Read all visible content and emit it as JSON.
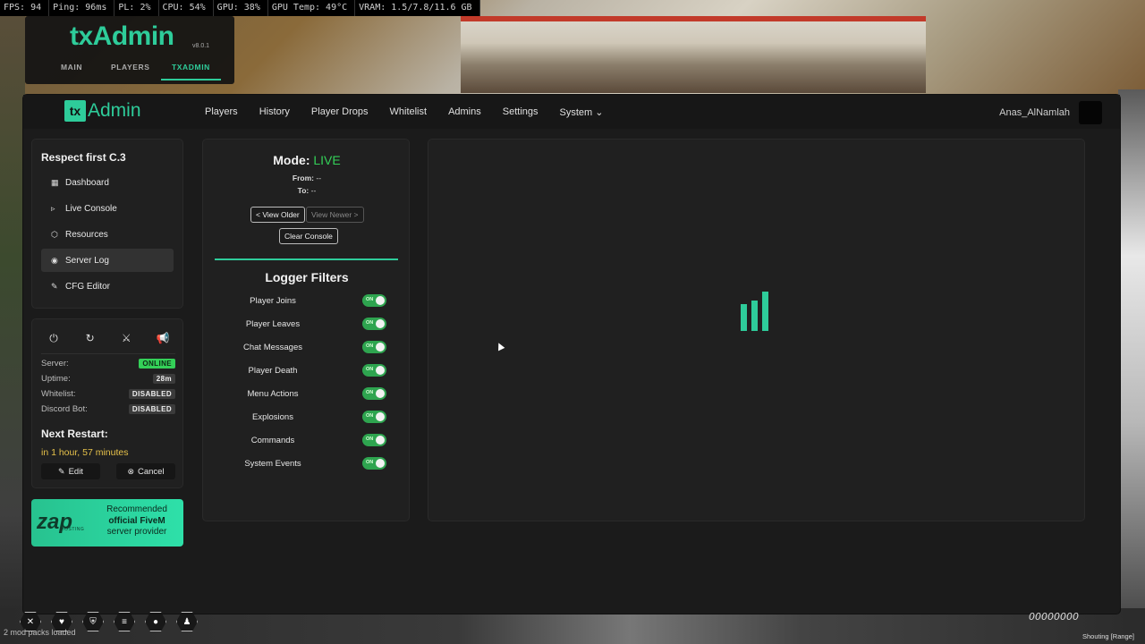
{
  "perf": {
    "fps": "FPS: 94",
    "ping": "Ping: 96ms",
    "pl": "PL: 2%",
    "cpu": "CPU: 54%",
    "gpu": "GPU: 38%",
    "gpu_temp": "GPU Temp: 49°C",
    "vram": "VRAM: 1.5/7.8/11.6 GB"
  },
  "overlay": {
    "logo": "txAdmin",
    "version": "v8.0.1",
    "tabs": [
      "MAIN",
      "PLAYERS",
      "TXADMIN"
    ],
    "active_tab": "TXADMIN"
  },
  "nav": {
    "brand_icon": "tx",
    "brand_text": "Admin",
    "links": [
      "Players",
      "History",
      "Player Drops",
      "Whitelist",
      "Admins",
      "Settings",
      "System ⌄"
    ],
    "username": "Anas_AlNamlah"
  },
  "sidebar": {
    "server_name": "Respect first C.3",
    "items": [
      {
        "label": "Dashboard",
        "icon": "dashboard-icon",
        "glyph": "▦"
      },
      {
        "label": "Live Console",
        "icon": "console-icon",
        "glyph": "▹"
      },
      {
        "label": "Resources",
        "icon": "cube-icon",
        "glyph": "⬡"
      },
      {
        "label": "Server Log",
        "icon": "eye-icon",
        "glyph": "◉"
      },
      {
        "label": "CFG Editor",
        "icon": "file-edit-icon",
        "glyph": "✎"
      }
    ],
    "active_item": "Server Log"
  },
  "status": {
    "controls": [
      {
        "name": "stop-server-icon",
        "glyph": "⏻"
      },
      {
        "name": "restart-icon",
        "glyph": "↻"
      },
      {
        "name": "kick-all-icon",
        "glyph": "⚔"
      },
      {
        "name": "announce-icon",
        "glyph": "📢"
      }
    ],
    "rows": [
      {
        "label": "Server:",
        "value": "ONLINE"
      },
      {
        "label": "Uptime:",
        "value": "28m"
      },
      {
        "label": "Whitelist:",
        "value": "DISABLED"
      },
      {
        "label": "Discord Bot:",
        "value": "DISABLED"
      }
    ],
    "next_restart_title": "Next Restart:",
    "next_restart_value": "in 1 hour, 57 minutes",
    "edit_label": "Edit",
    "cancel_label": "Cancel"
  },
  "promo": {
    "logo": "zap",
    "sub": "HOSTING",
    "line1": "Recommended",
    "line2": "official FiveM",
    "line3": "server provider"
  },
  "mode": {
    "label": "Mode:",
    "value": "LIVE",
    "from_label": "From:",
    "from_value": "--",
    "to_label": "To:",
    "to_value": "--",
    "view_older": "< View Older",
    "view_newer": "View Newer >",
    "clear_console": "Clear Console"
  },
  "filters": {
    "title": "Logger Filters",
    "toggle_text": "ON",
    "items": [
      "Player Joins",
      "Player Leaves",
      "Chat Messages",
      "Player Death",
      "Menu Actions",
      "Explosions",
      "Commands",
      "System Events"
    ]
  },
  "hud": {
    "mod_packs": "2 mod packs loaded",
    "money": "00000000",
    "voice": "Shouting [Range]",
    "icons": [
      "mic-off-icon",
      "heart-icon",
      "shield-icon",
      "food-icon",
      "water-icon",
      "stamina-icon"
    ]
  },
  "colors": {
    "accent": "#2ecc9a",
    "online": "#34d058",
    "restart_text": "#e6c14a"
  }
}
